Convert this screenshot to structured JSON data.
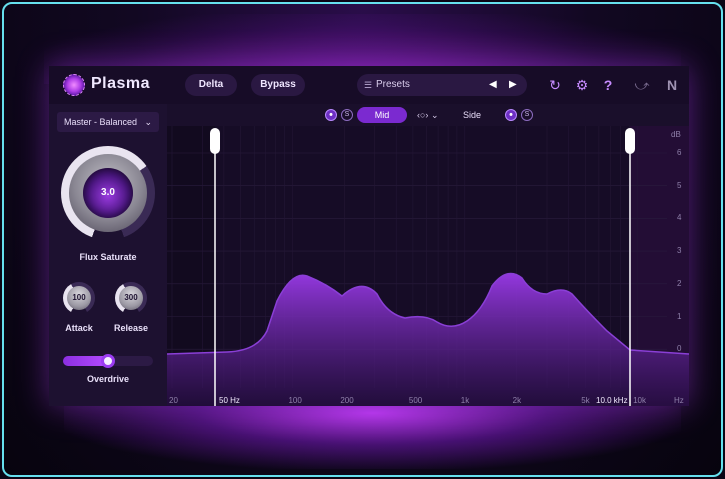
{
  "header": {
    "brand": "Plasma",
    "delta_label": "Delta",
    "bypass_label": "Bypass",
    "presets_label": "Presets",
    "prev_arrow": "◀",
    "next_arrow": "▶",
    "history_icon": "↻",
    "settings_icon": "⚙",
    "help_icon": "?",
    "ni_logo": "N"
  },
  "left_panel": {
    "preset_name": "Master - Balanced",
    "flux": {
      "value": "3.0",
      "label": "Flux Saturate"
    },
    "attack": {
      "value": "100",
      "label": "Attack"
    },
    "release": {
      "value": "300",
      "label": "Release"
    },
    "overdrive": {
      "label": "Overdrive",
      "level": 0.5
    }
  },
  "mode_bar": {
    "mid_label": "Mid",
    "side_label": "Side",
    "link_label": "‹○›",
    "solo_s": "S"
  },
  "graph": {
    "db_unit": "dB",
    "db_ticks": [
      "6",
      "5",
      "4",
      "3",
      "2",
      "1",
      "0"
    ],
    "freq_ticks": [
      "20",
      "100",
      "200",
      "500",
      "1k",
      "2k",
      "5k",
      "10k"
    ],
    "hz_unit": "Hz",
    "low_cut_label": "50 Hz",
    "high_cut_label": "10.0 kHz"
  },
  "colors": {
    "accent": "#7b2ad0",
    "border": "#66e0ee",
    "curve": "#8a3fd6"
  }
}
